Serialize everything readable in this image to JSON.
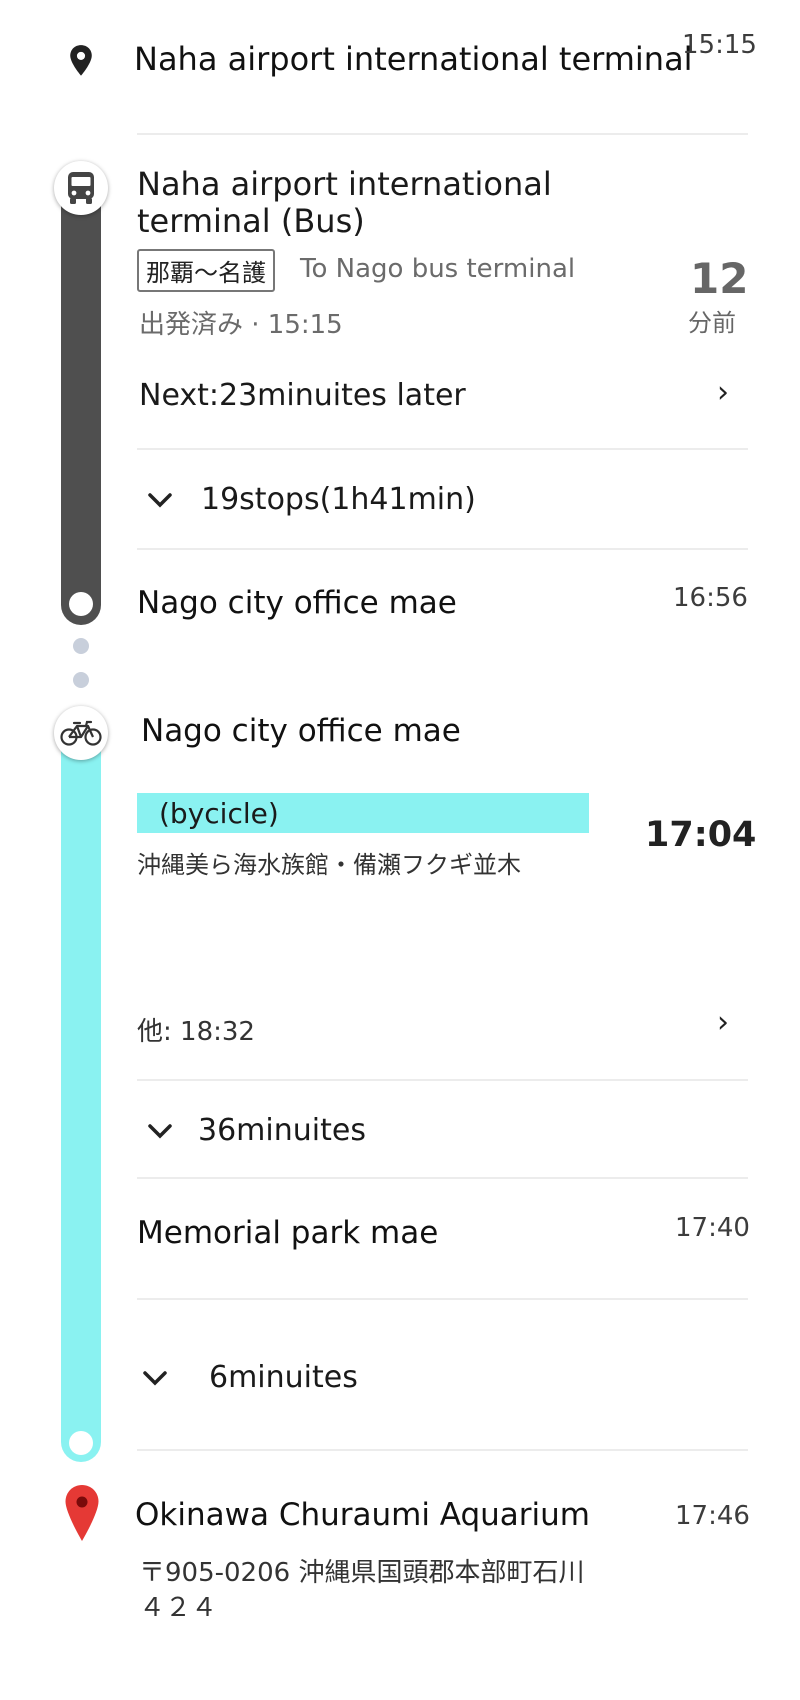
{
  "origin": {
    "name": "Naha airport international terminal",
    "time": "15:15",
    "icon": "map-pin-icon"
  },
  "bus_leg": {
    "icon": "bus-icon",
    "stop_name": "Naha airport international terminal (Bus)",
    "route_badge": "那覇〜名護",
    "direction": "To Nago bus terminal",
    "departure_status": "出発済み · 15:15",
    "countdown_value": "12",
    "countdown_unit": "分前",
    "next_label": "Next:23minuites later",
    "stops_summary": "19stops(1h41min)",
    "alight_stop": "Nago city office mae",
    "alight_time": "16:56",
    "color": "#4f4f4f"
  },
  "bike_leg": {
    "icon": "bicycle-icon",
    "start_name": "Nago city office mae",
    "mode_label": "(bycicle)",
    "destination_desc": "沖縄美ら海水族館・備瀬フクギ並木",
    "depart_time": "17:04",
    "other_label": "他: 18:32",
    "segment1_duration": "36minuites",
    "intermediate_stop": "Memorial park mae",
    "intermediate_time": "17:40",
    "segment2_duration": "6minuites",
    "color": "#8af2f1"
  },
  "destination": {
    "name": "Okinawa Churaumi Aquarium",
    "time": "17:46",
    "address_line1": "〒905-0206 沖縄県国頭郡本部町石川",
    "address_line2": "４２４",
    "icon": "red-pin-icon",
    "color": "#e53935"
  }
}
